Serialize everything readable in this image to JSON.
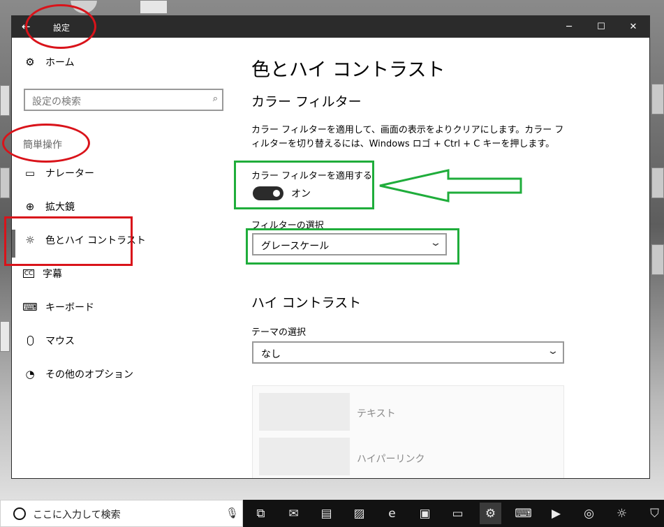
{
  "window": {
    "title": "設定",
    "back_glyph": "←",
    "minimize_glyph": "─",
    "maximize_glyph": "☐",
    "close_glyph": "✕"
  },
  "sidebar": {
    "home": {
      "label": "ホーム",
      "icon": "gear-icon"
    },
    "search": {
      "placeholder": "設定の検索",
      "icon": "search-icon"
    },
    "section_header": "簡単操作",
    "items": [
      {
        "label": "ナレーター",
        "icon": "narrator-icon"
      },
      {
        "label": "拡大鏡",
        "icon": "magnifier-icon"
      },
      {
        "label": "色とハイ コントラスト",
        "icon": "brightness-icon",
        "selected": true
      },
      {
        "label": "字幕",
        "icon": "closed-caption-icon"
      },
      {
        "label": "キーボード",
        "icon": "keyboard-icon"
      },
      {
        "label": "マウス",
        "icon": "mouse-icon"
      },
      {
        "label": "その他のオプション",
        "icon": "other-options-icon"
      }
    ]
  },
  "main": {
    "title": "色とハイ コントラスト",
    "color_filter": {
      "heading": "カラー フィルター",
      "description": "カラー フィルターを適用して、画面の表示をよりクリアにします。カラー フィルターを切り替えるには、Windows ロゴ + Ctrl + C キーを押します。",
      "toggle_label": "カラー フィルターを適用する",
      "toggle_state": "オン",
      "toggle_on": true,
      "select_label": "フィルターの選択",
      "select_value": "グレースケール"
    },
    "high_contrast": {
      "heading": "ハイ コントラスト",
      "theme_label": "テーマの選択",
      "theme_value": "なし",
      "preview": {
        "text_label": "テキスト",
        "hyperlink_label": "ハイパーリンク"
      }
    }
  },
  "taskbar": {
    "search_placeholder": "ここに入力して検索",
    "apps": [
      {
        "name": "task-view-icon",
        "glyph": "⧉"
      },
      {
        "name": "outlook-icon",
        "glyph": "✉"
      },
      {
        "name": "remote-desktop-icon",
        "glyph": "▤"
      },
      {
        "name": "notepad-icon",
        "glyph": "▨"
      },
      {
        "name": "edge-icon",
        "glyph": "e"
      },
      {
        "name": "cmd-icon",
        "glyph": "▣"
      },
      {
        "name": "file-explorer-icon",
        "glyph": "▭"
      },
      {
        "name": "settings-icon",
        "glyph": "⚙",
        "running": true
      },
      {
        "name": "keyboard-app-icon",
        "glyph": "⌨"
      },
      {
        "name": "media-player-icon",
        "glyph": "▶"
      },
      {
        "name": "groove-icon",
        "glyph": "◎"
      },
      {
        "name": "brightness-app-icon",
        "glyph": "☼"
      },
      {
        "name": "shield-app-icon",
        "glyph": "⛉"
      }
    ]
  },
  "colors": {
    "titlebar": "#2b2b2b",
    "annotation_red": "#d9131a",
    "annotation_green": "#1fad3b",
    "taskbar": "#121212"
  }
}
